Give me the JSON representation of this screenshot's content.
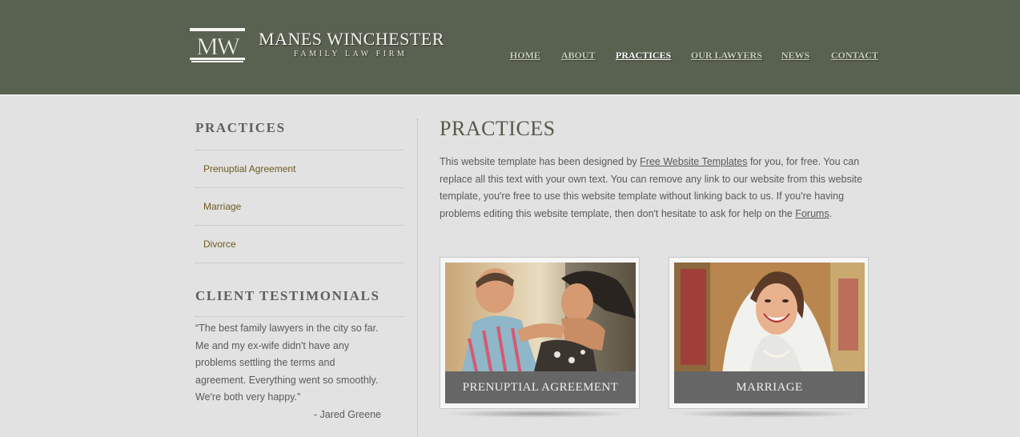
{
  "header": {
    "logo_mark": "MW",
    "logo_name": "MANES WINCHESTER",
    "logo_tagline": "FAMILY LAW FIRM",
    "background": "#596150"
  },
  "nav": {
    "items": [
      {
        "label": "HOME"
      },
      {
        "label": "ABOUT"
      },
      {
        "label": "PRACTICES",
        "active": true
      },
      {
        "label": "OUR LAWYERS"
      },
      {
        "label": "NEWS"
      },
      {
        "label": "CONTACT"
      }
    ]
  },
  "sidebar": {
    "practices_title": "PRACTICES",
    "practices": [
      {
        "label": "Prenuptial Agreement"
      },
      {
        "label": "Marriage"
      },
      {
        "label": "Divorce"
      }
    ],
    "testimonials_title": "CLIENT TESTIMONIALS",
    "testimonial_text": "“The best family lawyers in the city so far. Me and my ex-wife didn't have any problems settling the terms and agreement. Everything went so smoothly. We're both very happy.”",
    "testimonial_author": "- Jared Greene"
  },
  "main": {
    "title": "PRACTICES",
    "intro_part1": "This website template has been designed by ",
    "intro_link1": "Free Website Templates",
    "intro_part2": " for you, for free. You can replace all this text with your own text. You can remove any link to our website from this website template, you're free to use this website template without linking back to us. If you're having problems editing this website template, then don't hesitate to ask for help on the ",
    "intro_link2": "Forums",
    "intro_part3": ".",
    "cards": [
      {
        "label": "PRENUPTIAL AGREEMENT"
      },
      {
        "label": "MARRIAGE"
      }
    ]
  },
  "colors": {
    "header_bg": "#596150",
    "page_bg": "#e2e2e2",
    "sidebar_link": "#6c5a1e",
    "card_label_bg": "#666666"
  }
}
